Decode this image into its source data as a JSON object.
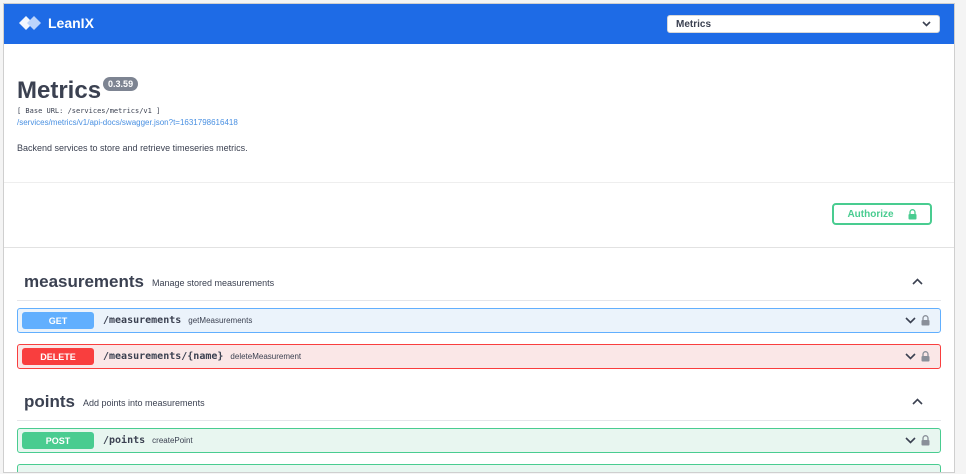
{
  "header": {
    "brand": "LeanIX",
    "spec_select": {
      "selected": "Metrics"
    }
  },
  "info": {
    "title": "Metrics",
    "version": "0.3.59",
    "base_url": "[ Base URL: /services/metrics/v1 ]",
    "spec_link": "/services/metrics/v1/api-docs/swagger.json?t=1631798616418",
    "description": "Backend services to store and retrieve timeseries metrics."
  },
  "auth": {
    "authorize_label": "Authorize"
  },
  "tags": [
    {
      "name": "measurements",
      "description": "Manage stored measurements",
      "operations": [
        {
          "method": "GET",
          "path": "/measurements",
          "summary": "getMeasurements"
        },
        {
          "method": "DELETE",
          "path": "/measurements/{name}",
          "summary": "deleteMeasurement"
        }
      ]
    },
    {
      "name": "points",
      "description": "Add points into measurements",
      "operations": [
        {
          "method": "POST",
          "path": "/points",
          "summary": "createPoint"
        }
      ]
    }
  ],
  "colors": {
    "topbar": "#1e6be6",
    "get": "#61affe",
    "delete": "#f93e3e",
    "post": "#49cc90"
  },
  "icons": [
    "leanix-logo-icon",
    "chevron-down-icon",
    "lock-icon",
    "chevron-up-icon"
  ]
}
